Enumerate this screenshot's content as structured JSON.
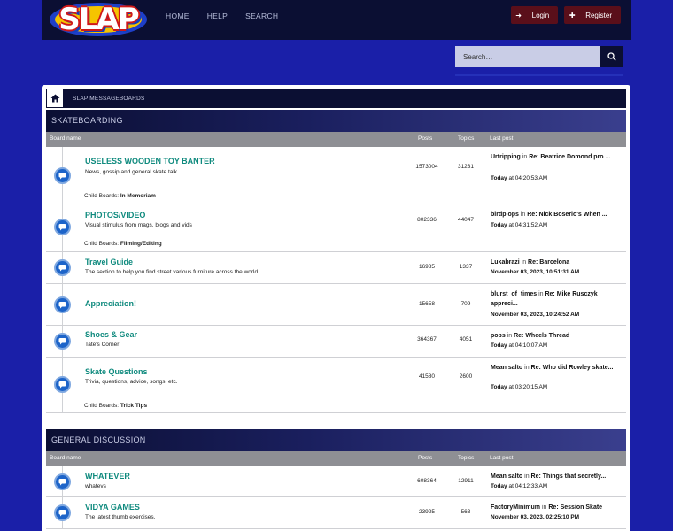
{
  "header": {
    "logo_text": "SLAP",
    "nav": [
      "HOME",
      "HELP",
      "SEARCH"
    ],
    "login_label": "Login",
    "register_label": "Register"
  },
  "search": {
    "placeholder": "Search…"
  },
  "breadcrumb": {
    "label": "SLAP MESSAGEBOARDS"
  },
  "columns": {
    "board": "Board name",
    "posts": "Posts",
    "topics": "Topics",
    "last": "Last post"
  },
  "child_prefix": "Child Boards:",
  "in_word": "in",
  "cat1": {
    "name": "SKATEBOARDING",
    "boards": [
      {
        "title": "USELESS WOODEN TOY BANTER",
        "desc": "News, gossip and general skate talk.",
        "posts": "1573004",
        "topics": "31231",
        "last_user": "Urtripping",
        "last_topic": "Re: Beatrice Domond pro ...",
        "last_day": "Today",
        "last_time": "at 04:20:53 AM",
        "child": "In Memoriam"
      },
      {
        "title": "PHOTOS/VIDEO",
        "desc": "Visual stimulus from mags, blogs and vids",
        "posts": "802336",
        "topics": "44047",
        "last_user": "birdplops",
        "last_topic": "Re: Nick Boserio's When ...",
        "last_day": "Today",
        "last_time": "at 04:31:52 AM",
        "child": "Filming/Editing"
      },
      {
        "title": "Travel Guide",
        "desc": "The section to help you find street various furniture across the world",
        "posts": "16985",
        "topics": "1337",
        "last_user": "Lukabrazi",
        "last_topic": "Re: Barcelona",
        "last_day": "",
        "last_time": "November 03, 2023, 10:51:31 AM",
        "child": ""
      },
      {
        "title": "Appreciation!",
        "desc": "",
        "posts": "15658",
        "topics": "709",
        "last_user": "blurst_of_times",
        "last_topic": "Re: Mike Rusczyk appreci...",
        "last_day": "",
        "last_time": "November 03, 2023, 10:24:52 AM",
        "child": ""
      },
      {
        "title": "Shoes & Gear",
        "desc": "Tate's Corner",
        "posts": "364367",
        "topics": "4051",
        "last_user": "pops",
        "last_topic": "Re: Wheels Thread",
        "last_day": "Today",
        "last_time": "at 04:10:07 AM",
        "child": ""
      },
      {
        "title": "Skate Questions",
        "desc": "Trivia, questions, advice, songs, etc.",
        "posts": "41580",
        "topics": "2600",
        "last_user": "Mean salto",
        "last_topic": "Re: Who did Rowley skate...",
        "last_day": "Today",
        "last_time": "at 03:20:15 AM",
        "child": "Trick Tips"
      }
    ]
  },
  "cat2": {
    "name": "GENERAL DISCUSSION",
    "boards": [
      {
        "title": "WHATEVER",
        "desc": "whatevs",
        "posts": "608364",
        "topics": "12911",
        "last_user": "Mean salto",
        "last_topic": "Re: Things that secretly...",
        "last_day": "Today",
        "last_time": "at 04:12:33 AM",
        "child": ""
      },
      {
        "title": "VIDYA GAMES",
        "desc": "The latest thumb exercises.",
        "posts": "23925",
        "topics": "563",
        "last_user": "FactoryMinimum",
        "last_topic": "Re: Session Skate",
        "last_day": "",
        "last_time": "November 03, 2023, 02:25:10 PM",
        "child": ""
      }
    ]
  }
}
